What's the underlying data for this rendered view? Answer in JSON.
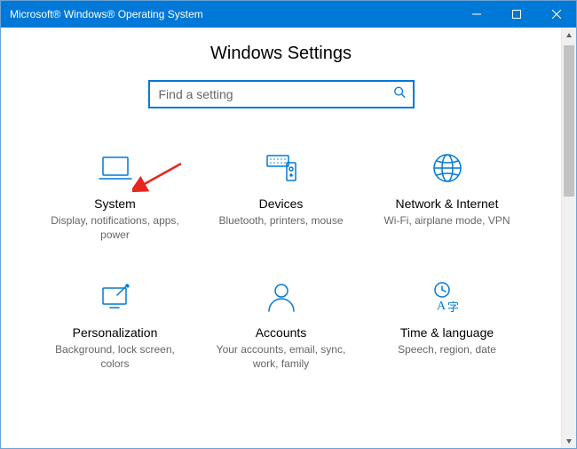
{
  "window": {
    "title": "Microsoft® Windows® Operating System"
  },
  "page": {
    "title": "Windows Settings"
  },
  "search": {
    "placeholder": "Find a setting"
  },
  "tiles": {
    "system": {
      "title": "System",
      "desc": "Display, notifications, apps, power"
    },
    "devices": {
      "title": "Devices",
      "desc": "Bluetooth, printers, mouse"
    },
    "network": {
      "title": "Network & Internet",
      "desc": "Wi-Fi, airplane mode, VPN"
    },
    "personalization": {
      "title": "Personalization",
      "desc": "Background, lock screen, colors"
    },
    "accounts": {
      "title": "Accounts",
      "desc": "Your accounts, email, sync, work, family"
    },
    "time": {
      "title": "Time & language",
      "desc": "Speech, region, date"
    }
  },
  "colors": {
    "accent": "#0078d7"
  }
}
